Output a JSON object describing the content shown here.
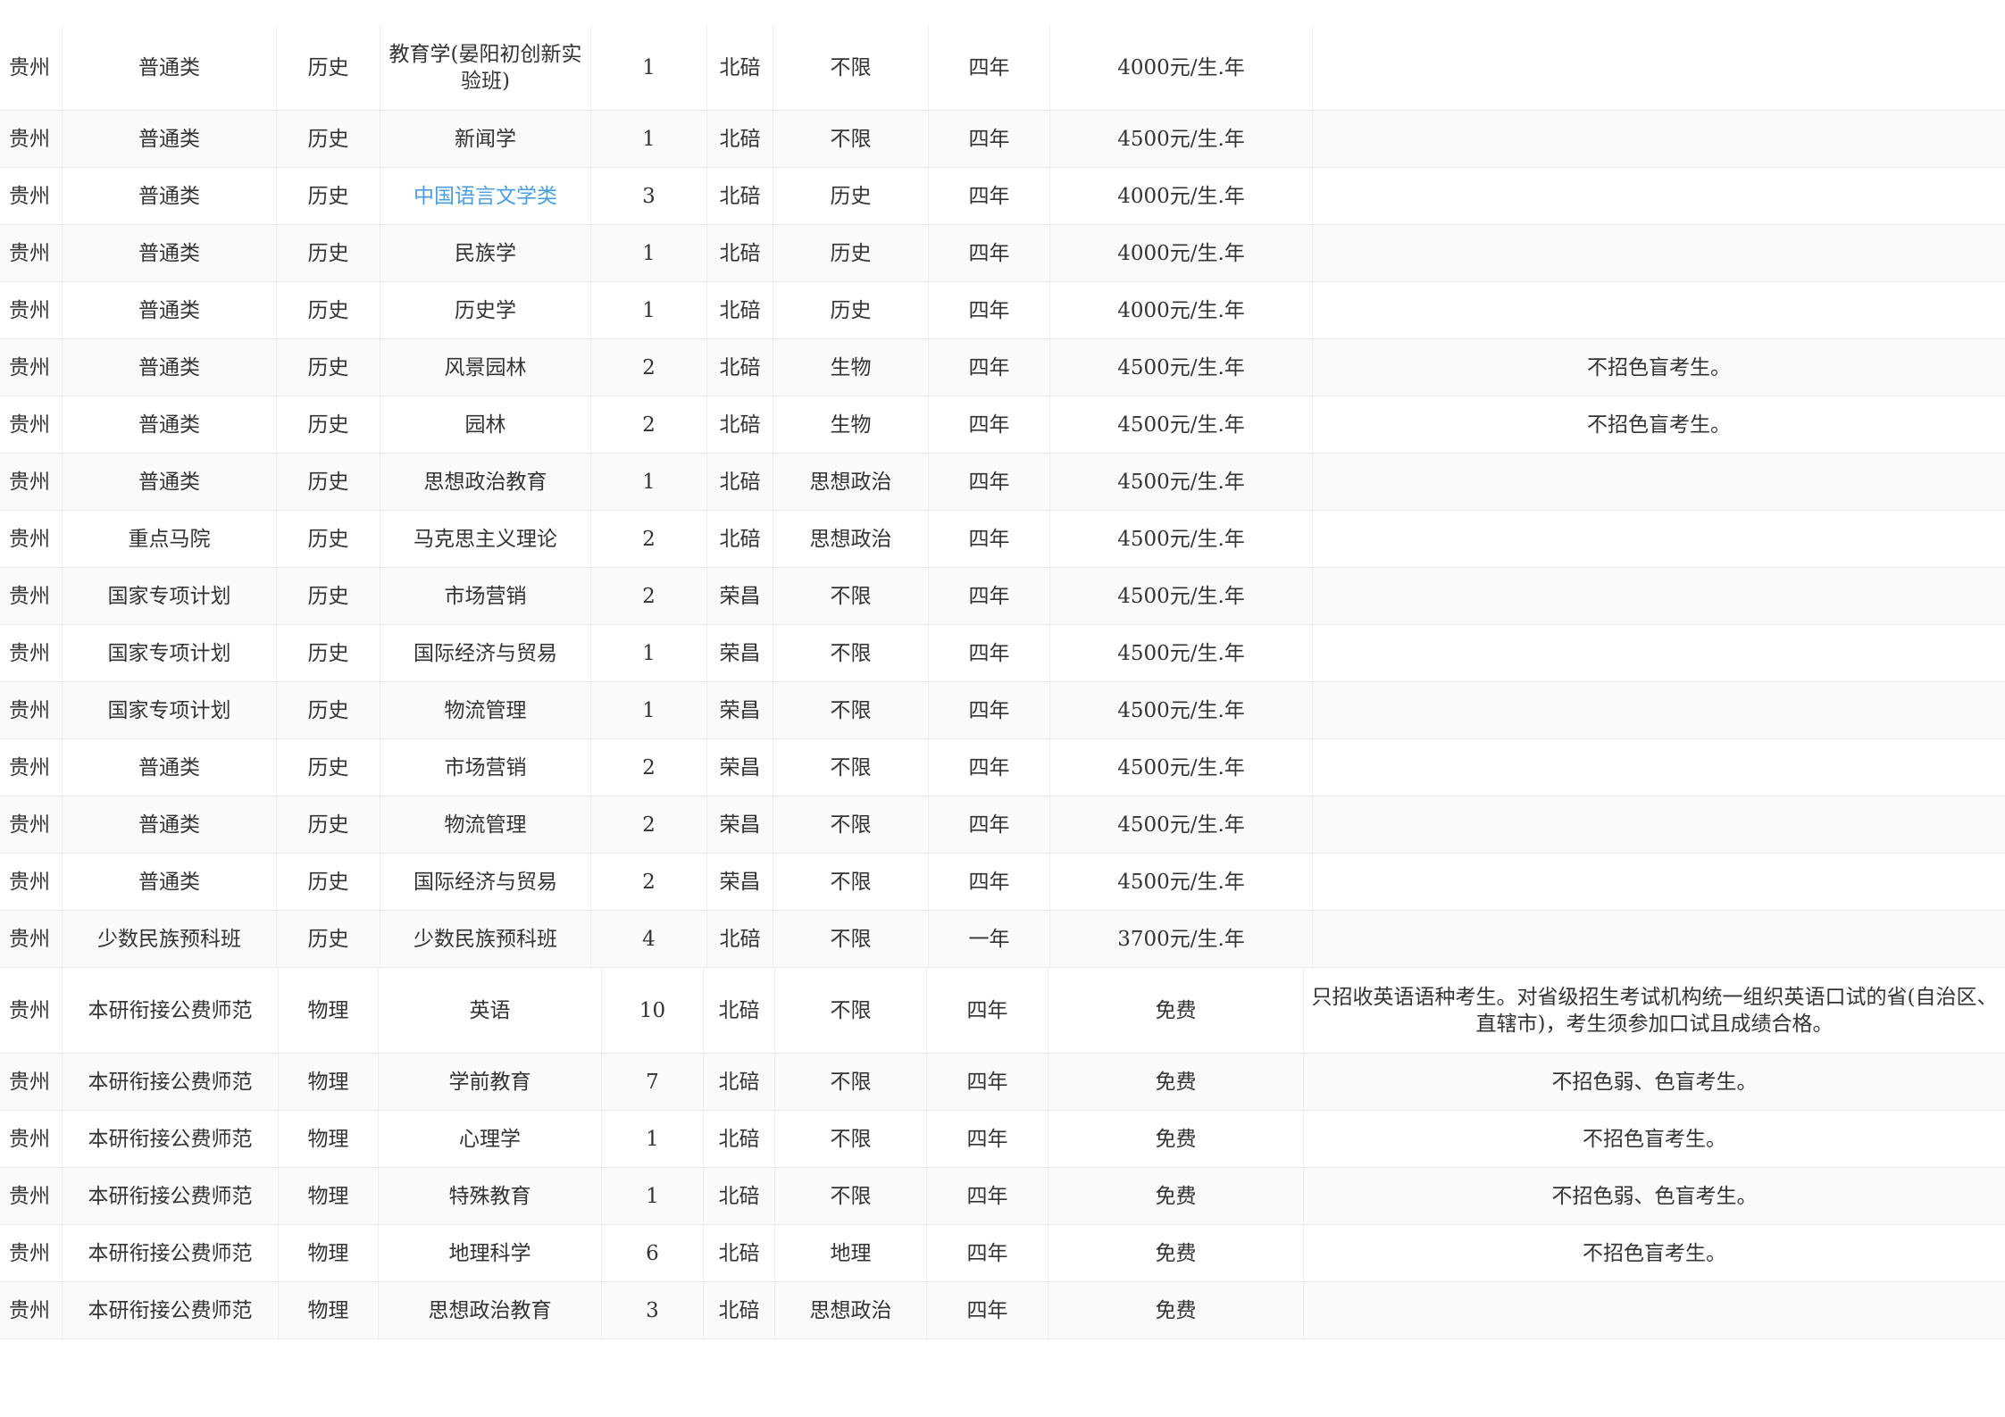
{
  "rows": [
    {
      "province": "贵州",
      "type": "普通类",
      "subject": "历史",
      "major": "教育学(晏阳初创新实验班)",
      "plan": "1",
      "campus": "北碚",
      "req": "不限",
      "years": "四年",
      "fee": "4000元/生.年",
      "note": ""
    },
    {
      "province": "贵州",
      "type": "普通类",
      "subject": "历史",
      "major": "新闻学",
      "plan": "1",
      "campus": "北碚",
      "req": "不限",
      "years": "四年",
      "fee": "4500元/生.年",
      "note": ""
    },
    {
      "province": "贵州",
      "type": "普通类",
      "subject": "历史",
      "major": "中国语言文学类",
      "major_link": true,
      "plan": "3",
      "campus": "北碚",
      "req": "历史",
      "years": "四年",
      "fee": "4000元/生.年",
      "note": ""
    },
    {
      "province": "贵州",
      "type": "普通类",
      "subject": "历史",
      "major": "民族学",
      "plan": "1",
      "campus": "北碚",
      "req": "历史",
      "years": "四年",
      "fee": "4000元/生.年",
      "note": ""
    },
    {
      "province": "贵州",
      "type": "普通类",
      "subject": "历史",
      "major": "历史学",
      "plan": "1",
      "campus": "北碚",
      "req": "历史",
      "years": "四年",
      "fee": "4000元/生.年",
      "note": ""
    },
    {
      "province": "贵州",
      "type": "普通类",
      "subject": "历史",
      "major": "风景园林",
      "plan": "2",
      "campus": "北碚",
      "req": "生物",
      "years": "四年",
      "fee": "4500元/生.年",
      "note": "不招色盲考生。"
    },
    {
      "province": "贵州",
      "type": "普通类",
      "subject": "历史",
      "major": "园林",
      "plan": "2",
      "campus": "北碚",
      "req": "生物",
      "years": "四年",
      "fee": "4500元/生.年",
      "note": "不招色盲考生。"
    },
    {
      "province": "贵州",
      "type": "普通类",
      "subject": "历史",
      "major": "思想政治教育",
      "plan": "1",
      "campus": "北碚",
      "req": "思想政治",
      "years": "四年",
      "fee": "4500元/生.年",
      "note": ""
    },
    {
      "province": "贵州",
      "type": "重点马院",
      "subject": "历史",
      "major": "马克思主义理论",
      "plan": "2",
      "campus": "北碚",
      "req": "思想政治",
      "years": "四年",
      "fee": "4500元/生.年",
      "note": ""
    },
    {
      "province": "贵州",
      "type": "国家专项计划",
      "subject": "历史",
      "major": "市场营销",
      "plan": "2",
      "campus": "荣昌",
      "req": "不限",
      "years": "四年",
      "fee": "4500元/生.年",
      "note": ""
    },
    {
      "province": "贵州",
      "type": "国家专项计划",
      "subject": "历史",
      "major": "国际经济与贸易",
      "plan": "1",
      "campus": "荣昌",
      "req": "不限",
      "years": "四年",
      "fee": "4500元/生.年",
      "note": ""
    },
    {
      "province": "贵州",
      "type": "国家专项计划",
      "subject": "历史",
      "major": "物流管理",
      "plan": "1",
      "campus": "荣昌",
      "req": "不限",
      "years": "四年",
      "fee": "4500元/生.年",
      "note": ""
    },
    {
      "province": "贵州",
      "type": "普通类",
      "subject": "历史",
      "major": "市场营销",
      "plan": "2",
      "campus": "荣昌",
      "req": "不限",
      "years": "四年",
      "fee": "4500元/生.年",
      "note": ""
    },
    {
      "province": "贵州",
      "type": "普通类",
      "subject": "历史",
      "major": "物流管理",
      "plan": "2",
      "campus": "荣昌",
      "req": "不限",
      "years": "四年",
      "fee": "4500元/生.年",
      "note": ""
    },
    {
      "province": "贵州",
      "type": "普通类",
      "subject": "历史",
      "major": "国际经济与贸易",
      "plan": "2",
      "campus": "荣昌",
      "req": "不限",
      "years": "四年",
      "fee": "4500元/生.年",
      "note": ""
    },
    {
      "province": "贵州",
      "type": "少数民族预科班",
      "subject": "历史",
      "major": "少数民族预科班",
      "plan": "4",
      "campus": "北碚",
      "req": "不限",
      "years": "一年",
      "fee": "3700元/生.年",
      "note": ""
    },
    {
      "province": "贵州",
      "type": "本研衔接公费师范",
      "subject": "物理",
      "major": "英语",
      "plan": "10",
      "campus": "北碚",
      "req": "不限",
      "years": "四年",
      "fee": "免费",
      "note": "只招收英语语种考生。对省级招生考试机构统一组织英语口试的省(自治区、直辖市)，考生须参加口试且成绩合格。"
    },
    {
      "province": "贵州",
      "type": "本研衔接公费师范",
      "subject": "物理",
      "major": "学前教育",
      "plan": "7",
      "campus": "北碚",
      "req": "不限",
      "years": "四年",
      "fee": "免费",
      "note": "不招色弱、色盲考生。"
    },
    {
      "province": "贵州",
      "type": "本研衔接公费师范",
      "subject": "物理",
      "major": "心理学",
      "plan": "1",
      "campus": "北碚",
      "req": "不限",
      "years": "四年",
      "fee": "免费",
      "note": "不招色盲考生。"
    },
    {
      "province": "贵州",
      "type": "本研衔接公费师范",
      "subject": "物理",
      "major": "特殊教育",
      "plan": "1",
      "campus": "北碚",
      "req": "不限",
      "years": "四年",
      "fee": "免费",
      "note": "不招色弱、色盲考生。"
    },
    {
      "province": "贵州",
      "type": "本研衔接公费师范",
      "subject": "物理",
      "major": "地理科学",
      "plan": "6",
      "campus": "北碚",
      "req": "地理",
      "years": "四年",
      "fee": "免费",
      "note": "不招色盲考生。"
    },
    {
      "province": "贵州",
      "type": "本研衔接公费师范",
      "subject": "物理",
      "major": "思想政治教育",
      "plan": "3",
      "campus": "北碚",
      "req": "思想政治",
      "years": "四年",
      "fee": "免费",
      "note": ""
    }
  ]
}
